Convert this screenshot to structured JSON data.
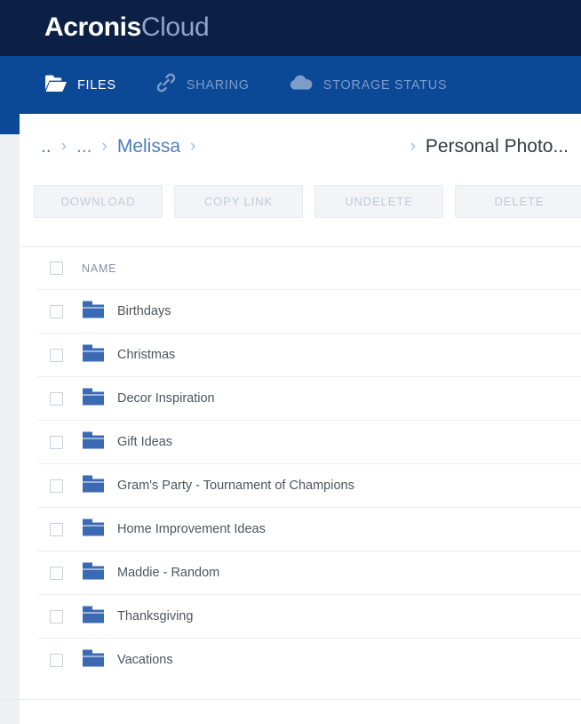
{
  "brand": {
    "name_bold": "Acronis",
    "name_light": "Cloud"
  },
  "nav": {
    "items": [
      {
        "label": "FILES",
        "icon": "folder-open-icon",
        "active": true
      },
      {
        "label": "SHARING",
        "icon": "link-chain-icon",
        "active": false
      },
      {
        "label": "STORAGE STATUS",
        "icon": "cloud-icon",
        "active": false
      }
    ]
  },
  "breadcrumb": {
    "separator": "›",
    "items": [
      {
        "label": "..",
        "type": "link"
      },
      {
        "label": "...",
        "type": "link"
      },
      {
        "label": "Melissa",
        "type": "link"
      },
      {
        "label": "Personal Photo...",
        "type": "current"
      }
    ]
  },
  "toolbar": {
    "buttons": [
      {
        "label": "DOWNLOAD",
        "disabled": true
      },
      {
        "label": "COPY LINK",
        "disabled": true
      },
      {
        "label": "UNDELETE",
        "disabled": true
      },
      {
        "label": "DELETE",
        "disabled": true
      }
    ]
  },
  "table": {
    "columns": [
      "NAME"
    ],
    "select_all_checked": false,
    "rows": [
      {
        "name": "Birthdays",
        "icon": "folder-icon",
        "checked": false
      },
      {
        "name": "Christmas",
        "icon": "folder-icon",
        "checked": false
      },
      {
        "name": "Decor Inspiration",
        "icon": "folder-icon",
        "checked": false
      },
      {
        "name": "Gift Ideas",
        "icon": "folder-icon",
        "checked": false
      },
      {
        "name": "Gram's Party - Tournament of Champions",
        "icon": "folder-icon",
        "checked": false
      },
      {
        "name": "Home Improvement Ideas",
        "icon": "folder-icon",
        "checked": false
      },
      {
        "name": "Maddie - Random",
        "icon": "folder-icon",
        "checked": false
      },
      {
        "name": "Thanksgiving",
        "icon": "folder-icon",
        "checked": false
      },
      {
        "name": "Vacations",
        "icon": "folder-icon",
        "checked": false
      }
    ]
  },
  "colors": {
    "brandbar_bg": "#0b2044",
    "navbar_bg": "#0b4896",
    "panel_bg": "#ffffff",
    "page_bg": "#eef0f4",
    "breadcrumb_link": "#4a7fc1",
    "breadcrumb_current": "#333a41",
    "folder_blue": "#3b6ab4",
    "button_disabled_text": "#c2c9d6"
  }
}
